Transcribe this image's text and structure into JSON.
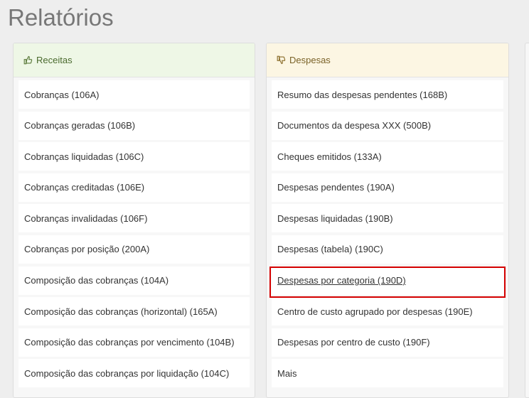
{
  "page": {
    "title": "Relatórios"
  },
  "receitas": {
    "heading": "Receitas",
    "icon": "thumbs-up-icon",
    "items": [
      "Cobranças (106A)",
      "Cobranças geradas (106B)",
      "Cobranças liquidadas (106C)",
      "Cobranças creditadas (106E)",
      "Cobranças invalidadas (106F)",
      "Cobranças por posição (200A)",
      "Composição das cobranças (104A)",
      "Composição das cobranças (horizontal) (165A)",
      "Composição das cobranças por vencimento (104B)",
      "Composição das cobranças por liquidação (104C)"
    ]
  },
  "despesas": {
    "heading": "Despesas",
    "icon": "thumbs-down-icon",
    "items": [
      "Resumo das despesas pendentes (168B)",
      "Documentos da despesa XXX (500B)",
      "Cheques emitidos (133A)",
      "Despesas pendentes (190A)",
      "Despesas liquidadas (190B)",
      "Despesas (tabela) (190C)",
      "Despesas por categoria (190D)",
      "Centro de custo agrupado por despesas (190E)",
      "Despesas por centro de custo (190F)",
      "Mais"
    ]
  },
  "colors": {
    "highlight": "#d40000",
    "receitas_heading_bg": "#eef7e6",
    "despesas_heading_bg": "#fcf6e3"
  }
}
